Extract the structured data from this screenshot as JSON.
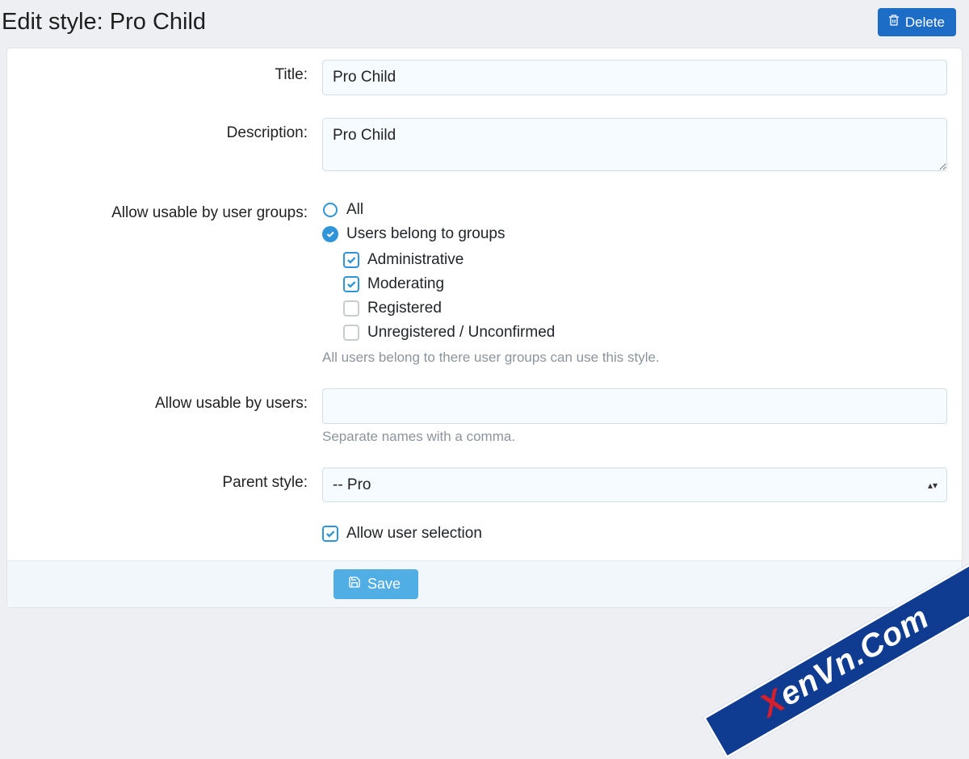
{
  "header": {
    "title": "Edit style: Pro Child",
    "delete_label": "Delete"
  },
  "form": {
    "title": {
      "label": "Title:",
      "value": "Pro Child"
    },
    "description": {
      "label": "Description:",
      "value": "Pro Child"
    },
    "allow_groups": {
      "label": "Allow usable by user groups:",
      "options": {
        "all": {
          "label": "All",
          "selected": false
        },
        "belong": {
          "label": "Users belong to groups",
          "selected": true
        }
      },
      "groups": [
        {
          "label": "Administrative",
          "checked": true
        },
        {
          "label": "Moderating",
          "checked": true
        },
        {
          "label": "Registered",
          "checked": false
        },
        {
          "label": "Unregistered / Unconfirmed",
          "checked": false
        }
      ],
      "hint": "All users belong to there user groups can use this style."
    },
    "allow_users": {
      "label": "Allow usable by users:",
      "value": "",
      "hint": "Separate names with a comma."
    },
    "parent_style": {
      "label": "Parent style:",
      "value": "-- Pro"
    },
    "allow_user_selection": {
      "label": "Allow user selection",
      "checked": true
    }
  },
  "footer": {
    "save_label": "Save"
  },
  "watermark": {
    "prefix": "X",
    "rest": "enVn.Com"
  }
}
